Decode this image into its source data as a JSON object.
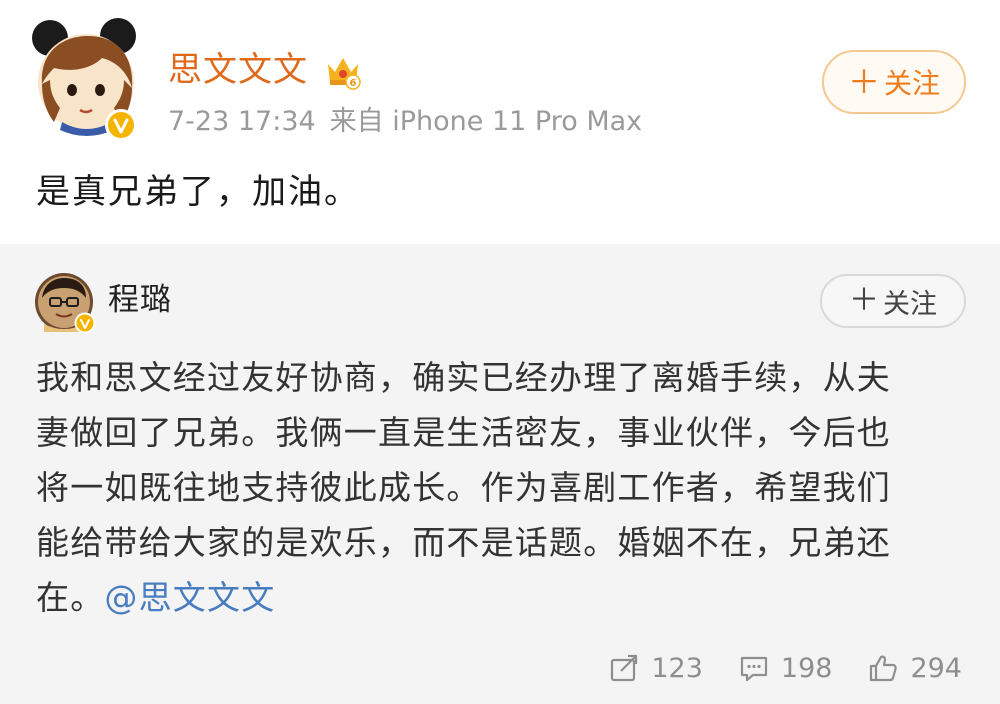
{
  "post": {
    "author": "思文文文",
    "time": "7-23 17:34",
    "source": "来自 iPhone 11 Pro Max",
    "follow_label": "关注",
    "follow_plus": "＋",
    "text": "是真兄弟了，加油。",
    "badge_level": "6"
  },
  "retweet": {
    "author": "程璐",
    "follow_label": "关注",
    "follow_plus": "＋",
    "lines": [
      "我和思文经过友好协商，确实已经办理了离婚手续，从夫",
      "妻做回了兄弟。我俩一直是生活密友，事业伙伴，今后也",
      "将一如既往地支持彼此成长。作为喜剧工作者，希望我们",
      "能给带给大家的是欢乐，而不是话题。婚姻不在，兄弟还"
    ],
    "last_line_prefix": "在。",
    "mention": "@思文文文",
    "stats": {
      "repost": "123",
      "comment": "198",
      "like": "294"
    }
  },
  "icons": {
    "verified_badge": "verified-badge-icon",
    "crown_badge": "crown-badge-icon",
    "repost": "repost-icon",
    "comment": "comment-icon",
    "like": "like-icon"
  },
  "colors": {
    "author_orange": "#e06a1b",
    "follow_orange": "#ef7c1a",
    "mention_blue": "#4a7dbf",
    "meta_gray": "#9a9a9a",
    "verified_gold": "#f5b400"
  }
}
